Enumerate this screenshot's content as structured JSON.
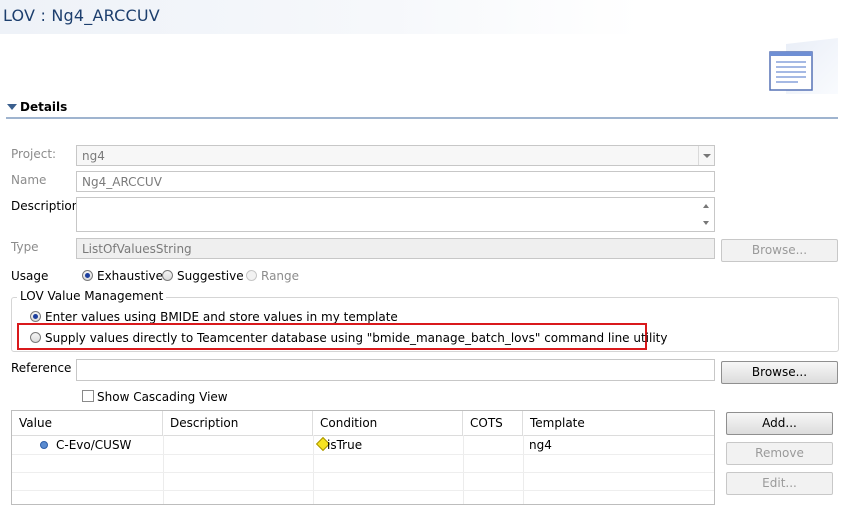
{
  "header": {
    "title": "LOV : Ng4_ARCCUV",
    "icon": "list-document-icon"
  },
  "section": {
    "title": "Details"
  },
  "form": {
    "project_label": "Project:",
    "project_value": "ng4",
    "name_label": "Name",
    "name_value": "Ng4_ARCCUV",
    "description_label": "Description",
    "description_value": "",
    "type_label": "Type",
    "type_value": "ListOfValuesString",
    "type_browse": "Browse...",
    "usage_label": "Usage",
    "usage_options": [
      {
        "label": "Exhaustive",
        "selected": true,
        "enabled": true
      },
      {
        "label": "Suggestive",
        "selected": false,
        "enabled": true
      },
      {
        "label": "Range",
        "selected": false,
        "enabled": false
      }
    ]
  },
  "lov_value_management": {
    "title": "LOV Value Management",
    "option1": "Enter values using BMIDE and store values in my template",
    "option1_selected": true,
    "option2": "Supply values directly to Teamcenter database using \"bmide_manage_batch_lovs\" command line utility",
    "option2_selected": false,
    "highlight_color": "#d9191c"
  },
  "reference": {
    "label": "Reference",
    "value": "",
    "browse": "Browse..."
  },
  "show_cascading": {
    "label": "Show Cascading View",
    "checked": false
  },
  "table": {
    "columns": [
      "Value",
      "Description",
      "Condition",
      "COTS",
      "Template"
    ],
    "rows": [
      {
        "value": "C-Evo/CUSW",
        "description": "",
        "condition": "isTrue",
        "cots": "",
        "template": "ng4"
      }
    ]
  },
  "side_buttons": {
    "add": "Add...",
    "remove": "Remove",
    "edit": "Edit..."
  }
}
